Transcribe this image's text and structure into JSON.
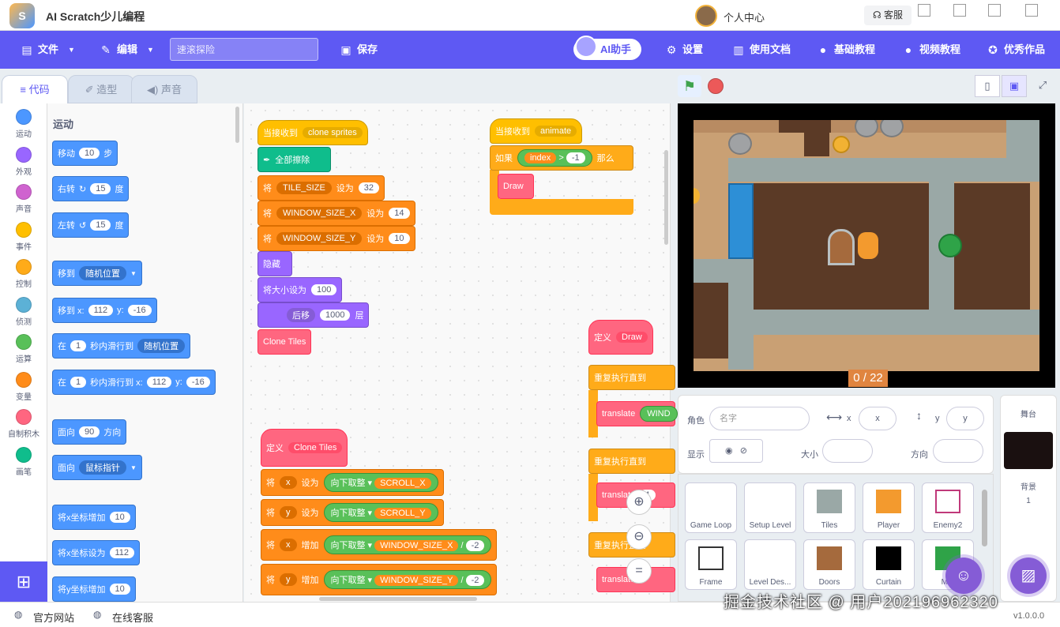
{
  "app": {
    "title": "AI Scratch少儿编程",
    "logo_text": "S"
  },
  "user": {
    "label": "个人中心",
    "service": "客服"
  },
  "menubar": {
    "file": "文件",
    "edit": "编辑",
    "search_placeholder": "速滚探险",
    "save": "保存",
    "ai": "AI助手",
    "settings": "设置",
    "docs": "使用文档",
    "basic": "基础教程",
    "video": "视频教程",
    "works": "优秀作品"
  },
  "tabs": {
    "code": "代码",
    "costume": "造型",
    "sound": "声音"
  },
  "categories": [
    {
      "label": "运动",
      "color": "#4c97ff"
    },
    {
      "label": "外观",
      "color": "#9966ff"
    },
    {
      "label": "声音",
      "color": "#cf63cf"
    },
    {
      "label": "事件",
      "color": "#ffbf00"
    },
    {
      "label": "控制",
      "color": "#ffab19"
    },
    {
      "label": "侦测",
      "color": "#5cb1d6"
    },
    {
      "label": "运算",
      "color": "#59c059"
    },
    {
      "label": "变量",
      "color": "#ff8c1a"
    },
    {
      "label": "自制积木",
      "color": "#ff6680"
    },
    {
      "label": "画笔",
      "color": "#0fbd8c"
    }
  ],
  "palette": {
    "title": "运动",
    "move": {
      "a": "移动",
      "v": "10",
      "b": "步"
    },
    "turn_right": {
      "a": "右转",
      "v": "15",
      "b": "度"
    },
    "turn_left": {
      "a": "左转",
      "v": "15",
      "b": "度"
    },
    "goto": {
      "a": "移到",
      "dd": "随机位置"
    },
    "goto_xy": {
      "a": "移到 x:",
      "x": "112",
      "b": "y:",
      "y": "-16"
    },
    "glide": {
      "a": "在",
      "v": "1",
      "b": "秒内滑行到",
      "dd": "随机位置"
    },
    "glide_xy": {
      "a": "在",
      "v": "1",
      "b": "秒内滑行到 x:",
      "x": "112",
      "c": "y:",
      "y": "-16"
    },
    "point_dir": {
      "a": "面向",
      "v": "90",
      "b": "方向"
    },
    "point_towards": {
      "a": "面向",
      "dd": "鼠标指针"
    },
    "change_x": {
      "a": "将x坐标增加",
      "v": "10"
    },
    "set_x": {
      "a": "将x坐标设为",
      "v": "112"
    },
    "change_y": {
      "a": "将y坐标增加",
      "v": "10"
    }
  },
  "scripts": {
    "when_recv1": "当接收到",
    "msg1": "clone sprites",
    "erase": "全部擦除",
    "set": "将",
    "to": "设为",
    "inc": "增加",
    "var_tile": "TILE_SIZE",
    "val_tile": "32",
    "var_wx": "WINDOW_SIZE_X",
    "val_wx": "14",
    "var_wy": "WINDOW_SIZE_Y",
    "val_wy": "10",
    "hide": "隐藏",
    "size_a": "将大小设为",
    "size_v": "100",
    "back_dd": "后移",
    "back_v": "1000",
    "back_b": "层",
    "clone_tiles": "Clone Tiles",
    "when_recv2": "当接收到",
    "msg2": "animate",
    "if": "如果",
    "index": "index",
    "gt": ">",
    "neg1": "-1",
    "then": "那么",
    "draw": "Draw",
    "define": "定义",
    "define2": "定义",
    "repeat": "重复执行直到",
    "repeat2": "重复执行直到",
    "repeat3": "重复执行直到",
    "translate": "translate",
    "translate2": "translate",
    "translate3": "translate",
    "win_trunc": "WIND",
    "var_x": "x",
    "var_y": "y",
    "floor": "向下取整",
    "scroll_x": "SCROLL_X",
    "scroll_y": "SCROLL_Y",
    "div": "/",
    "neg2": "-2",
    "wx2": "WINDOW_SIZE_X",
    "wy2": "WINDOW_SIZE_Y",
    "one": "1"
  },
  "stage": {
    "counter": "0 / 22"
  },
  "sprite_info": {
    "role": "角色",
    "name_placeholder": "名字",
    "x": "x",
    "y": "y",
    "show": "显示",
    "size": "大小",
    "direction": "方向"
  },
  "sprites": [
    {
      "name": "Game Loop"
    },
    {
      "name": "Setup Level"
    },
    {
      "name": "Tiles"
    },
    {
      "name": "Player"
    },
    {
      "name": "Enemy2"
    },
    {
      "name": "Frame"
    },
    {
      "name": "Level Des..."
    },
    {
      "name": "Doors"
    },
    {
      "name": "Curtain"
    },
    {
      "name": "M..."
    }
  ],
  "stage_panel": {
    "title": "舞台",
    "backdrop": "背景",
    "count": "1"
  },
  "status": {
    "website": "官方网站",
    "support": "在线客服",
    "version": "v1.0.0.0"
  },
  "watermark": "掘金技术社区 @ 用户2021969623​20",
  "colors": {
    "accent": "#5e59f3",
    "motion": "#4c97ff",
    "variables": "#ff8c1a",
    "events": "#ffbf00",
    "custom": "#ff6680"
  }
}
